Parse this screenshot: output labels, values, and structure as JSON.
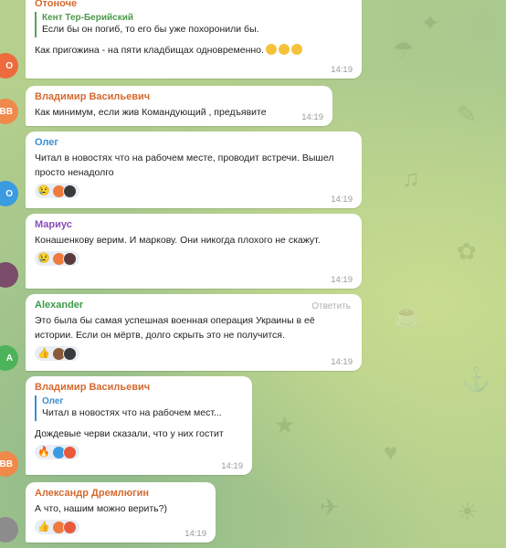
{
  "messages": [
    {
      "sender": "Отоноче",
      "sender_color": "#d46a2f",
      "avatar_letter": "O",
      "avatar_color": "#ee6b3e",
      "reply_to": {
        "sender": "Кент Тер-Берийский",
        "text": "Если бы он погиб, то его бы уже похоронили бы."
      },
      "text": "Как пригожина - на пяти кладбищах одновременно.",
      "time": "14:19"
    },
    {
      "sender": "Владимир Васильевич",
      "sender_color": "#d46a2f",
      "avatar_letter": "ВВ",
      "avatar_color": "#f08a4b",
      "text": "Как минимум, если жив Командующий , предъявите",
      "time": "14:19"
    },
    {
      "sender": "Олег",
      "sender_color": "#3b8fd0",
      "avatar_letter": "O",
      "avatar_color": "#3b9be0",
      "text": "Читал в новостях что на рабочем месте, проводит встречи. Вышел просто ненадолго",
      "reaction_emoji": "😢",
      "time": "14:19"
    },
    {
      "sender": "Мариус",
      "sender_color": "#8a4db8",
      "avatar_letter": "",
      "avatar_color": "#7a4c6a",
      "text": "Конашенкову верим. И маркову. Они никогда плохого не скажут.",
      "reaction_emoji": "😢",
      "time": "14:19"
    },
    {
      "sender": "Alexander",
      "sender_color": "#3c9a4a",
      "avatar_letter": "A",
      "avatar_color": "#4cb35a",
      "reply_action": "Ответить",
      "text": "Это была бы самая успешная военная операция Украины в её истории. Если он мёртв, долго скрыть это не получится.",
      "reaction_emoji": "👍",
      "time": "14:19"
    },
    {
      "sender": "Владимир Васильевич",
      "sender_color": "#d46a2f",
      "avatar_letter": "ВВ",
      "avatar_color": "#f08a4b",
      "reply_to": {
        "sender": "Олег",
        "text": "Читал в новостях что на рабочем мест..."
      },
      "text": "Дождевые черви сказали, что у них гостит",
      "reaction_emoji": "🔥",
      "time": "14:19"
    },
    {
      "sender": "Александр Дремлюгин",
      "sender_color": "#d46a2f",
      "avatar_letter": "",
      "avatar_color": "#8c8c8c",
      "text": "А что, нашим можно верить?)",
      "reaction_emoji": "👍",
      "time": "14:19"
    }
  ]
}
